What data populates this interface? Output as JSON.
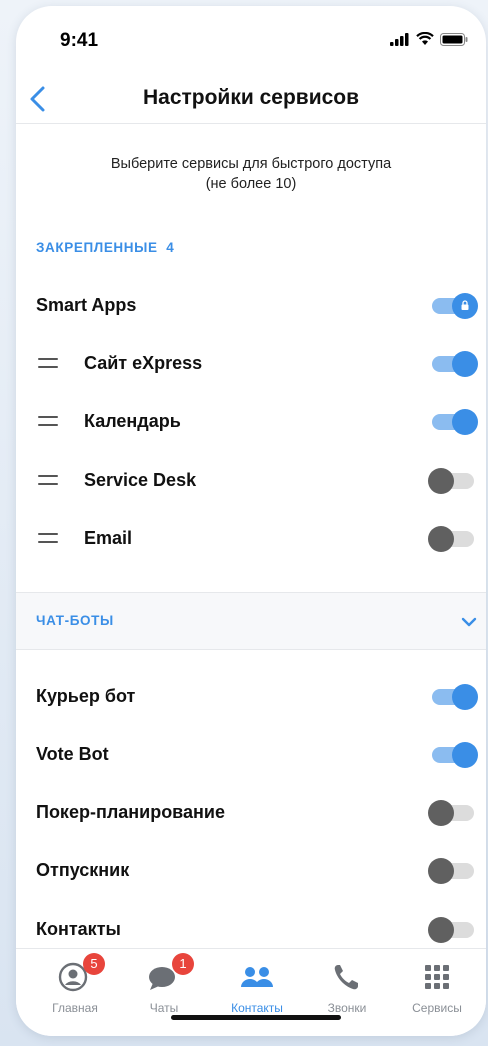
{
  "status_bar": {
    "time": "9:41"
  },
  "nav": {
    "title": "Настройки сервисов"
  },
  "subtitle": "Выберите сервисы для быстрого доступа\n(не более 10)",
  "pinned": {
    "label": "ЗАКРЕПЛЕННЫЕ",
    "count": "4",
    "smart_apps": {
      "label": "Smart Apps",
      "enabled": true,
      "locked": true
    },
    "items": [
      {
        "label": "Сайт eXpress",
        "enabled": true
      },
      {
        "label": "Календарь",
        "enabled": true
      },
      {
        "label": "Service Desk",
        "enabled": false
      },
      {
        "label": "Email",
        "enabled": false
      }
    ]
  },
  "chatbots": {
    "label": "ЧАТ-БОТЫ",
    "items": [
      {
        "label": "Курьер бот",
        "enabled": true
      },
      {
        "label": "Vote Bot",
        "enabled": true
      },
      {
        "label": "Покер-планирование",
        "enabled": false
      },
      {
        "label": "Отпускник",
        "enabled": false
      },
      {
        "label": "Контакты",
        "enabled": false
      }
    ]
  },
  "tabs": [
    {
      "label": "Главная",
      "icon": "profile-icon",
      "badge": "5",
      "active": false
    },
    {
      "label": "Чаты",
      "icon": "chat-icon",
      "badge": "1",
      "active": false
    },
    {
      "label": "Контакты",
      "icon": "contacts-icon",
      "badge": "",
      "active": true
    },
    {
      "label": "Звонки",
      "icon": "phone-icon",
      "badge": "",
      "active": false
    },
    {
      "label": "Сервисы",
      "icon": "grid-icon",
      "badge": "",
      "active": false
    }
  ],
  "colors": {
    "accent": "#3a8ee6",
    "badge": "#e8453c",
    "toggle_off": "#606060"
  }
}
